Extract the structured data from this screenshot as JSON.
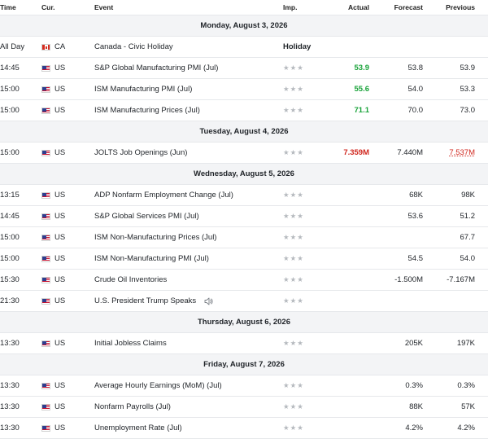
{
  "columns": {
    "time": "Time",
    "currency": "Cur.",
    "event": "Event",
    "importance": "Imp.",
    "actual": "Actual",
    "forecast": "Forecast",
    "previous": "Previous"
  },
  "colors": {
    "positive": "#19a33a",
    "negative": "#d0261d",
    "star_inactive": "#b5b9be",
    "day_bg": "#f3f4f6"
  },
  "days": [
    {
      "label": "Monday, August 3, 2026",
      "events": [
        {
          "time": "All Day",
          "flag": "ca-flag-icon",
          "currency": "CA",
          "event": "Canada - Civic Holiday",
          "importance": "Holiday",
          "actual": "",
          "actual_status": "",
          "forecast": "",
          "previous": "",
          "previous_status": ""
        }
      ]
    },
    {
      "label": "",
      "events": [
        {
          "time": "14:45",
          "flag": "us-flag-icon",
          "currency": "US",
          "event": "S&P Global Manufacturing PMI  (Jul)",
          "importance": "★★★",
          "actual": "53.9",
          "actual_status": "up",
          "forecast": "53.8",
          "previous": "53.9",
          "previous_status": ""
        },
        {
          "time": "15:00",
          "flag": "us-flag-icon",
          "currency": "US",
          "event": "ISM Manufacturing PMI  (Jul)",
          "importance": "★★★",
          "actual": "55.6",
          "actual_status": "up",
          "forecast": "54.0",
          "previous": "53.3",
          "previous_status": ""
        },
        {
          "time": "15:00",
          "flag": "us-flag-icon",
          "currency": "US",
          "event": "ISM Manufacturing Prices  (Jul)",
          "importance": "★★★",
          "actual": "71.1",
          "actual_status": "up",
          "forecast": "70.0",
          "previous": "73.0",
          "previous_status": ""
        }
      ]
    },
    {
      "label": "Tuesday, August 4, 2026",
      "events": [
        {
          "time": "15:00",
          "flag": "us-flag-icon",
          "currency": "US",
          "event": "JOLTS Job Openings  (Jun)",
          "importance": "★★★",
          "actual": "7.359M",
          "actual_status": "down",
          "forecast": "7.440M",
          "previous": "7.537M",
          "previous_status": "revised"
        }
      ]
    },
    {
      "label": "Wednesday, August 5, 2026",
      "events": [
        {
          "time": "13:15",
          "flag": "us-flag-icon",
          "currency": "US",
          "event": "ADP Nonfarm Employment Change  (Jul)",
          "importance": "★★★",
          "actual": "",
          "actual_status": "",
          "forecast": "68K",
          "previous": "98K",
          "previous_status": ""
        },
        {
          "time": "14:45",
          "flag": "us-flag-icon",
          "currency": "US",
          "event": "S&P Global Services PMI  (Jul)",
          "importance": "★★★",
          "actual": "",
          "actual_status": "",
          "forecast": "53.6",
          "previous": "51.2",
          "previous_status": ""
        },
        {
          "time": "15:00",
          "flag": "us-flag-icon",
          "currency": "US",
          "event": "ISM Non-Manufacturing Prices  (Jul)",
          "importance": "★★★",
          "actual": "",
          "actual_status": "",
          "forecast": "",
          "previous": "67.7",
          "previous_status": ""
        },
        {
          "time": "15:00",
          "flag": "us-flag-icon",
          "currency": "US",
          "event": "ISM Non-Manufacturing PMI  (Jul)",
          "importance": "★★★",
          "actual": "",
          "actual_status": "",
          "forecast": "54.5",
          "previous": "54.0",
          "previous_status": ""
        },
        {
          "time": "15:30",
          "flag": "us-flag-icon",
          "currency": "US",
          "event": "Crude Oil Inventories",
          "importance": "★★★",
          "actual": "",
          "actual_status": "",
          "forecast": "-1.500M",
          "previous": "-7.167M",
          "previous_status": ""
        },
        {
          "time": "21:30",
          "flag": "us-flag-icon",
          "currency": "US",
          "event": "U.S. President Trump Speaks",
          "importance": "★★★",
          "actual": "",
          "actual_status": "",
          "forecast": "",
          "previous": "",
          "previous_status": "",
          "extra_icon": "speaker-icon"
        }
      ]
    },
    {
      "label": "Thursday, August 6, 2026",
      "events": [
        {
          "time": "13:30",
          "flag": "us-flag-icon",
          "currency": "US",
          "event": "Initial Jobless Claims",
          "importance": "★★★",
          "actual": "",
          "actual_status": "",
          "forecast": "205K",
          "previous": "197K",
          "previous_status": ""
        }
      ]
    },
    {
      "label": "Friday, August 7, 2026",
      "events": [
        {
          "time": "13:30",
          "flag": "us-flag-icon",
          "currency": "US",
          "event": "Average Hourly Earnings (MoM)  (Jul)",
          "importance": "★★★",
          "actual": "",
          "actual_status": "",
          "forecast": "0.3%",
          "previous": "0.3%",
          "previous_status": ""
        },
        {
          "time": "13:30",
          "flag": "us-flag-icon",
          "currency": "US",
          "event": "Nonfarm Payrolls  (Jul)",
          "importance": "★★★",
          "actual": "",
          "actual_status": "",
          "forecast": "88K",
          "previous": "57K",
          "previous_status": ""
        },
        {
          "time": "13:30",
          "flag": "us-flag-icon",
          "currency": "US",
          "event": "Unemployment Rate  (Jul)",
          "importance": "★★★",
          "actual": "",
          "actual_status": "",
          "forecast": "4.2%",
          "previous": "4.2%",
          "previous_status": ""
        }
      ]
    }
  ]
}
